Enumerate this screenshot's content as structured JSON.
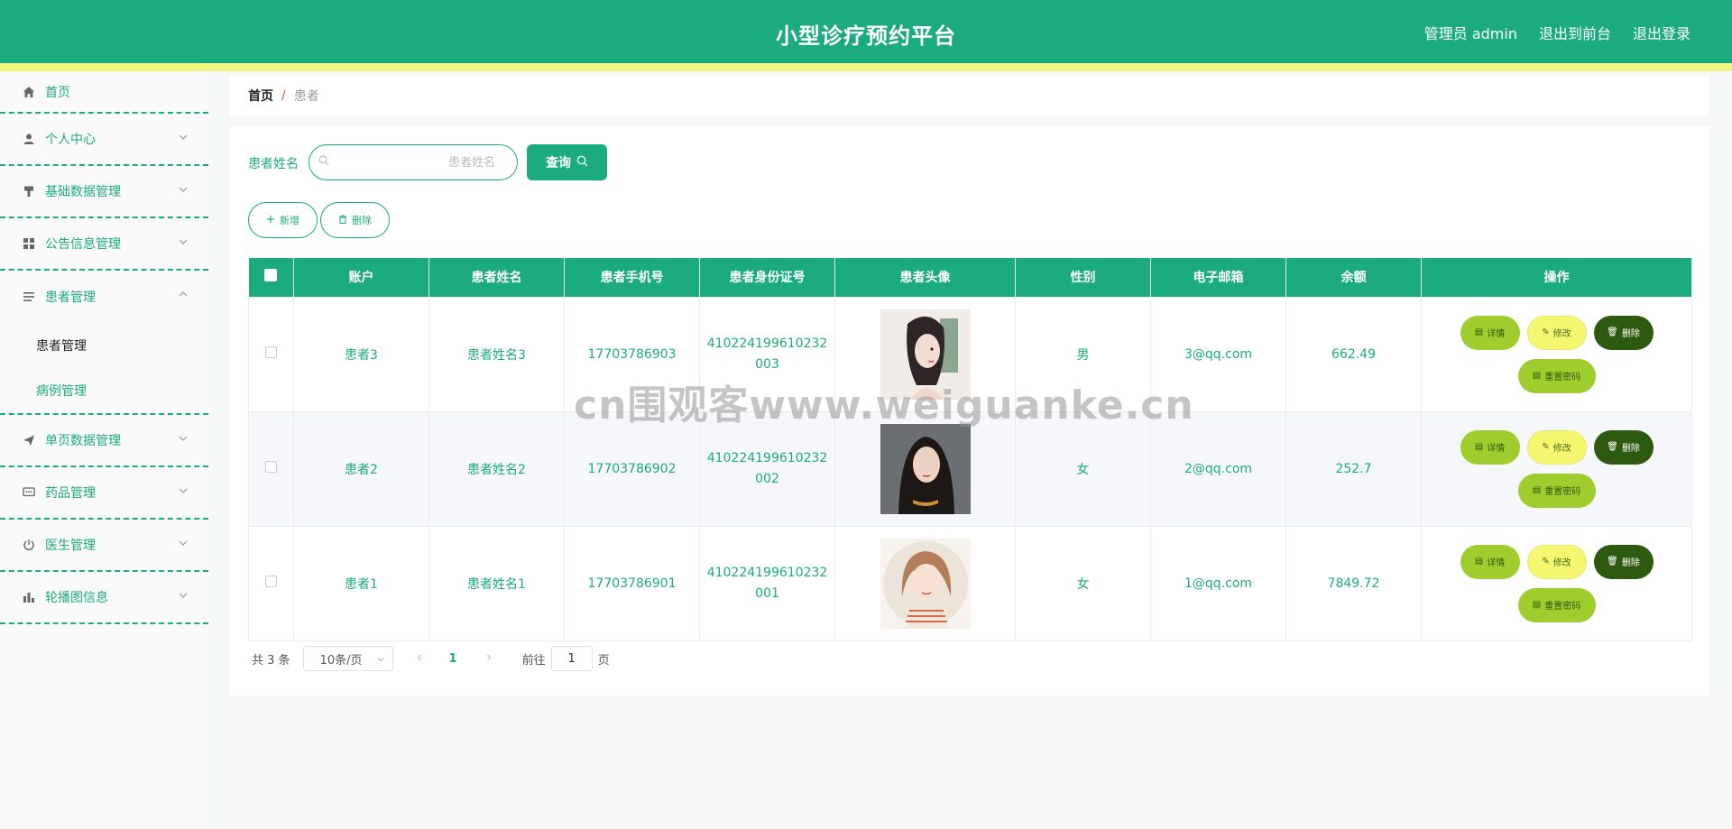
{
  "header": {
    "title": "小型诊疗预约平台",
    "admin_label": "管理员 admin",
    "exit_front": "退出到前台",
    "logout": "退出登录"
  },
  "sidebar": {
    "items": [
      {
        "label": "首页",
        "icon": "home-icon"
      },
      {
        "label": "个人中心",
        "icon": "user-icon"
      },
      {
        "label": "基础数据管理",
        "icon": "brush-icon"
      },
      {
        "label": "公告信息管理",
        "icon": "grid-icon"
      },
      {
        "label": "患者管理",
        "icon": "list-icon",
        "expanded": true,
        "children": [
          "患者管理",
          "病例管理"
        ]
      },
      {
        "label": "单页数据管理",
        "icon": "send-icon"
      },
      {
        "label": "药品管理",
        "icon": "chat-icon"
      },
      {
        "label": "医生管理",
        "icon": "power-icon"
      },
      {
        "label": "轮播图信息",
        "icon": "bar-chart-icon"
      }
    ]
  },
  "breadcrumb": {
    "home": "首页",
    "separator": "/",
    "current": "患者"
  },
  "search": {
    "label": "患者姓名",
    "placeholder": "患者姓名",
    "value": "",
    "query_button": "查询"
  },
  "actions": {
    "add": "新增",
    "delete": "删除"
  },
  "table": {
    "columns": [
      "账户",
      "患者姓名",
      "患者手机号",
      "患者身份证号",
      "患者头像",
      "性别",
      "电子邮箱",
      "余额",
      "操作"
    ],
    "rows": [
      {
        "account": "患者3",
        "name": "患者姓名3",
        "phone": "17703786903",
        "id_number": "410224199610232003",
        "avatar": "avatar-illustrated-woman",
        "gender": "男",
        "email": "3@qq.com",
        "balance": "662.49"
      },
      {
        "account": "患者2",
        "name": "患者姓名2",
        "phone": "17703786902",
        "id_number": "410224199610232002",
        "avatar": "avatar-photo-woman",
        "gender": "女",
        "email": "2@qq.com",
        "balance": "252.7"
      },
      {
        "account": "患者1",
        "name": "患者姓名1",
        "phone": "17703786901",
        "id_number": "410224199610232001",
        "avatar": "avatar-cartoon-girl",
        "gender": "女",
        "email": "1@qq.com",
        "balance": "7849.72"
      }
    ],
    "row_actions": {
      "detail": "详情",
      "edit": "修改",
      "delete": "删除",
      "reset_password": "重置密码"
    }
  },
  "pagination": {
    "total_text": "共 3 条",
    "page_size": "10条/页",
    "current_page": "1",
    "goto_label": "前往",
    "goto_value": "1",
    "page_unit": "页"
  },
  "watermark": "cn围观客www.weiguanke.cn",
  "colors": {
    "primary": "#1bab7e",
    "stripe": "#eff67f",
    "detail_btn": "#9fcd2d",
    "edit_btn": "#f5f771",
    "delete_btn": "#2d5a0f"
  }
}
